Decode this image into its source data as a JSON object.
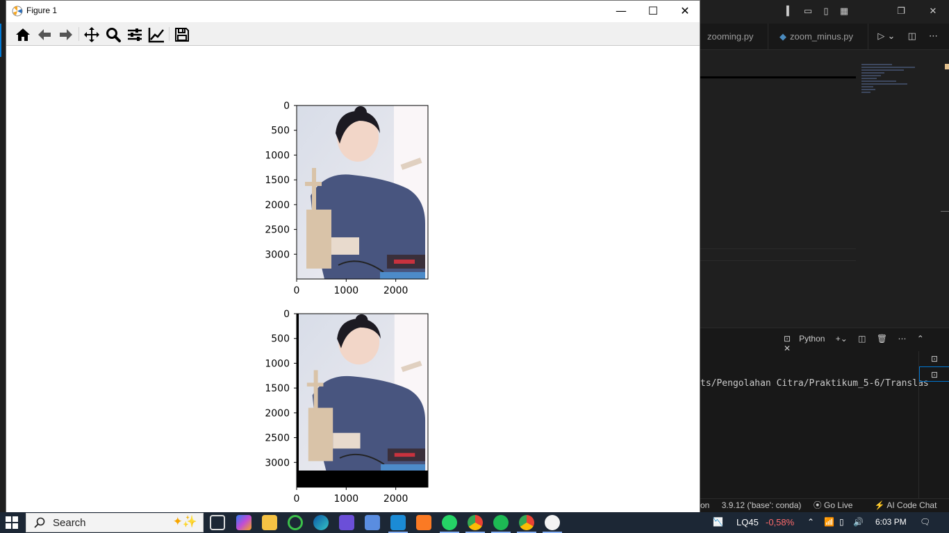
{
  "figure_window": {
    "title": "Figure 1",
    "controls": {
      "minimize": "—",
      "maximize": "☐",
      "close": "✕"
    }
  },
  "toolbar": {
    "buttons": [
      "home-icon",
      "back-arrow-icon",
      "forward-arrow-icon",
      "pan-icon",
      "zoom-icon",
      "subplots-config-icon",
      "edit-axis-icon",
      "save-icon"
    ]
  },
  "chart_data": [
    {
      "type": "image",
      "x_ticks": [
        "0",
        "1000",
        "2000"
      ],
      "y_ticks": [
        "0",
        "500",
        "1000",
        "1500",
        "2000",
        "2500",
        "3000"
      ],
      "xlim": [
        0,
        2650
      ],
      "ylim": [
        3500,
        0
      ]
    },
    {
      "type": "image",
      "x_ticks": [
        "0",
        "1000",
        "2000"
      ],
      "y_ticks": [
        "0",
        "500",
        "1000",
        "1500",
        "2000",
        "2500",
        "3000"
      ],
      "xlim": [
        0,
        2650
      ],
      "ylim": [
        3500,
        0
      ]
    }
  ],
  "vscode": {
    "tabs": [
      {
        "label": "zooming.py"
      },
      {
        "label": "zoom_minus.py"
      }
    ],
    "panel": {
      "terminal_label": "Python",
      "terminal_text": "ts/Pengolahan Citra/Praktikum_5-6/Translas"
    },
    "status": {
      "language": "on",
      "interpreter": "3.9.12 ('base': conda)",
      "go_live": "Go Live",
      "ai_chat": "AI Code Chat"
    }
  },
  "taskbar": {
    "search_label": "Search",
    "stock_symbol": "LQ45",
    "stock_change": "-0,58%",
    "time": "6:03 PM"
  },
  "colors": {
    "accent": "#0078d4",
    "stock_negative": "#ff6b6b"
  }
}
